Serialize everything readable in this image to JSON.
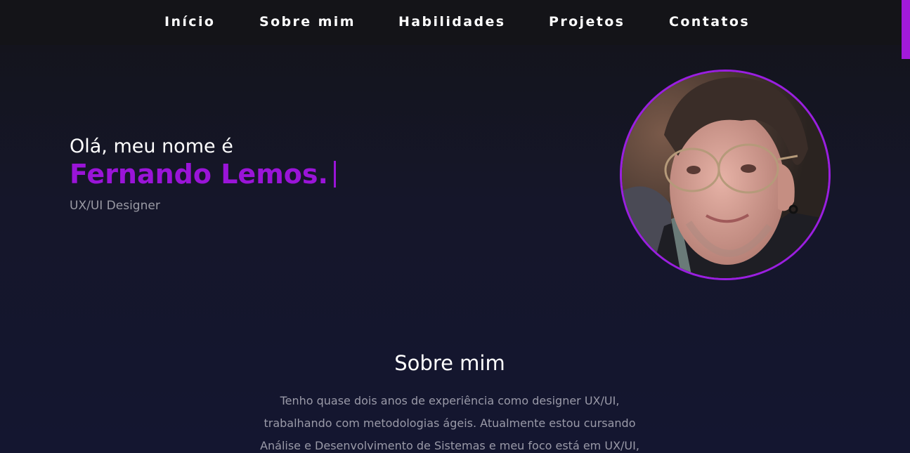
{
  "nav": {
    "items": [
      {
        "label": "Início"
      },
      {
        "label": "Sobre mim"
      },
      {
        "label": "Habilidades"
      },
      {
        "label": "Projetos"
      },
      {
        "label": "Contatos"
      }
    ]
  },
  "hero": {
    "greeting": "Olá, meu nome é",
    "name": "Fernando Lemos.",
    "role": "UX/UI Designer"
  },
  "about": {
    "title": "Sobre mim",
    "lines": [
      "Tenho quase dois anos de experiência como designer UX/UI,",
      "trabalhando com metodologias ágeis. Atualmente estou cursando",
      "Análise e Desenvolvimento de Sistemas e meu foco está em UX/UI,"
    ]
  },
  "colors": {
    "accent": "#9a14d8",
    "background": "#141630",
    "nav_background": "#141418",
    "muted_text": "#9a9aa8"
  }
}
